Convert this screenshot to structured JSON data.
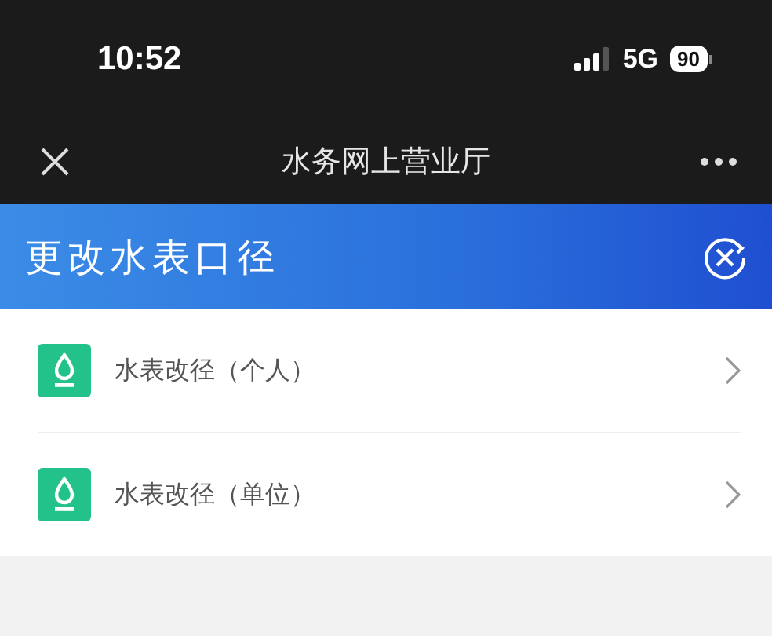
{
  "status_bar": {
    "time": "10:52",
    "network": "5G",
    "battery": "90"
  },
  "nav_bar": {
    "title": "水务网上营业厅"
  },
  "header": {
    "title": "更改水表口径"
  },
  "items": [
    {
      "label": "水表改径（个人）"
    },
    {
      "label": "水表改径（单位）"
    }
  ]
}
